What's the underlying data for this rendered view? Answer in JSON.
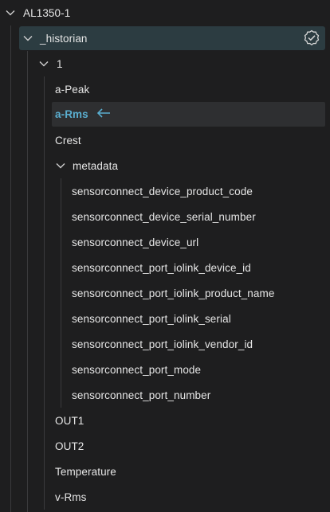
{
  "tree": {
    "root": {
      "label": "AL1350-1"
    },
    "historian": {
      "label": "_historian",
      "status_icon": "check-circle-icon",
      "highlight_color": "#2c3c41"
    },
    "folder_1": {
      "label": "1"
    },
    "items_level3": [
      {
        "label": "a-Peak"
      },
      {
        "label": "a-Rms",
        "selected": true,
        "marker_icon": "arrow-left-icon"
      },
      {
        "label": "Crest"
      }
    ],
    "metadata": {
      "label": "metadata",
      "children": [
        {
          "label": "sensorconnect_device_product_code"
        },
        {
          "label": "sensorconnect_device_serial_number"
        },
        {
          "label": "sensorconnect_device_url"
        },
        {
          "label": "sensorconnect_port_iolink_device_id"
        },
        {
          "label": "sensorconnect_port_iolink_product_name"
        },
        {
          "label": "sensorconnect_port_iolink_serial"
        },
        {
          "label": "sensorconnect_port_iolink_vendor_id"
        },
        {
          "label": "sensorconnect_port_mode"
        },
        {
          "label": "sensorconnect_port_number"
        }
      ]
    },
    "items_after": [
      {
        "label": "OUT1"
      },
      {
        "label": "OUT2"
      },
      {
        "label": "Temperature"
      },
      {
        "label": "v-Rms"
      }
    ]
  },
  "colors": {
    "background": "#1e1e1f",
    "selected_text": "#5aaed0",
    "text": "#e6e6e6"
  }
}
